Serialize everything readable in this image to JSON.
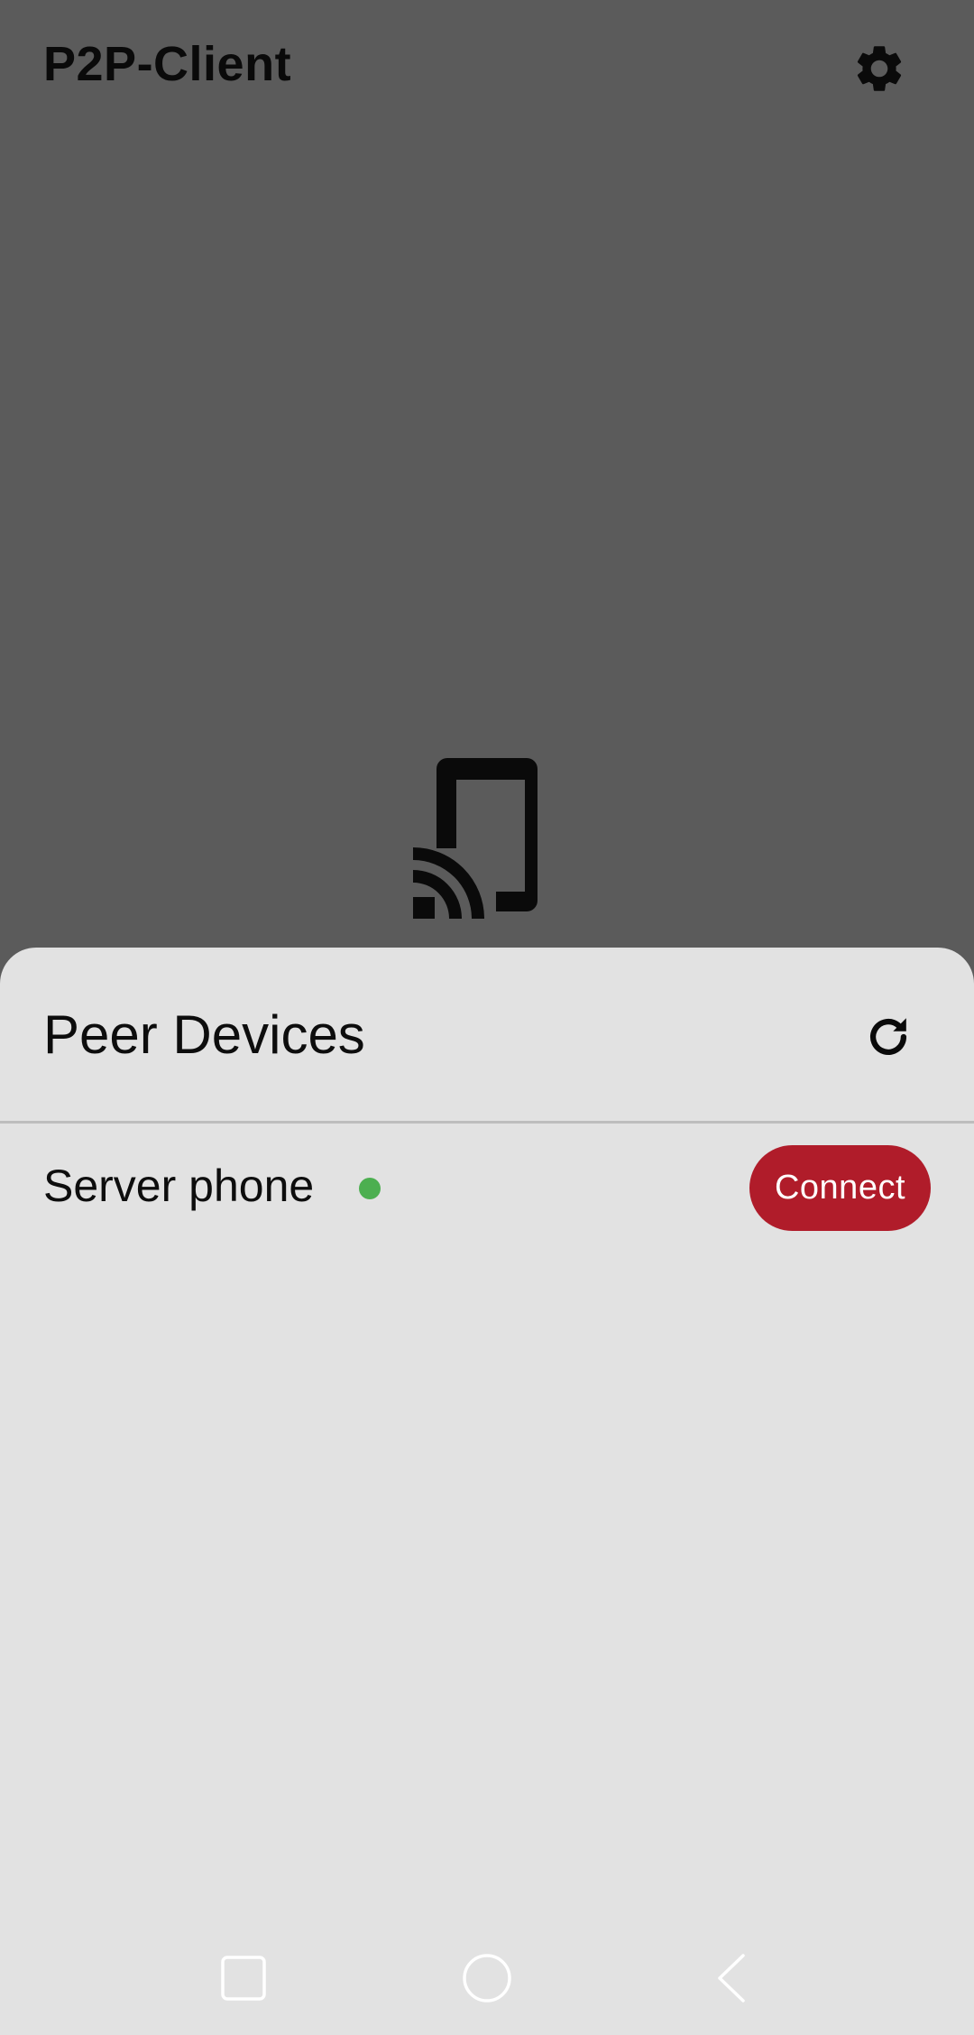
{
  "app_bar": {
    "title": "P2P-Client",
    "settings_icon": "gear-icon"
  },
  "hero": {
    "icon": "cast-phone-icon"
  },
  "sheet": {
    "title": "Peer Devices",
    "refresh_icon": "refresh-icon",
    "devices": [
      {
        "name": "Server phone",
        "status_color": "#4caf50",
        "action_label": "Connect"
      }
    ]
  },
  "nav_bar": {
    "items": [
      "recents-square-icon",
      "home-circle-icon",
      "back-chevron-icon"
    ]
  },
  "colors": {
    "background_dim": "#5b5b5b",
    "sheet": "#e2e2e2",
    "accent": "#b01c2a",
    "status_online": "#4caf50"
  }
}
